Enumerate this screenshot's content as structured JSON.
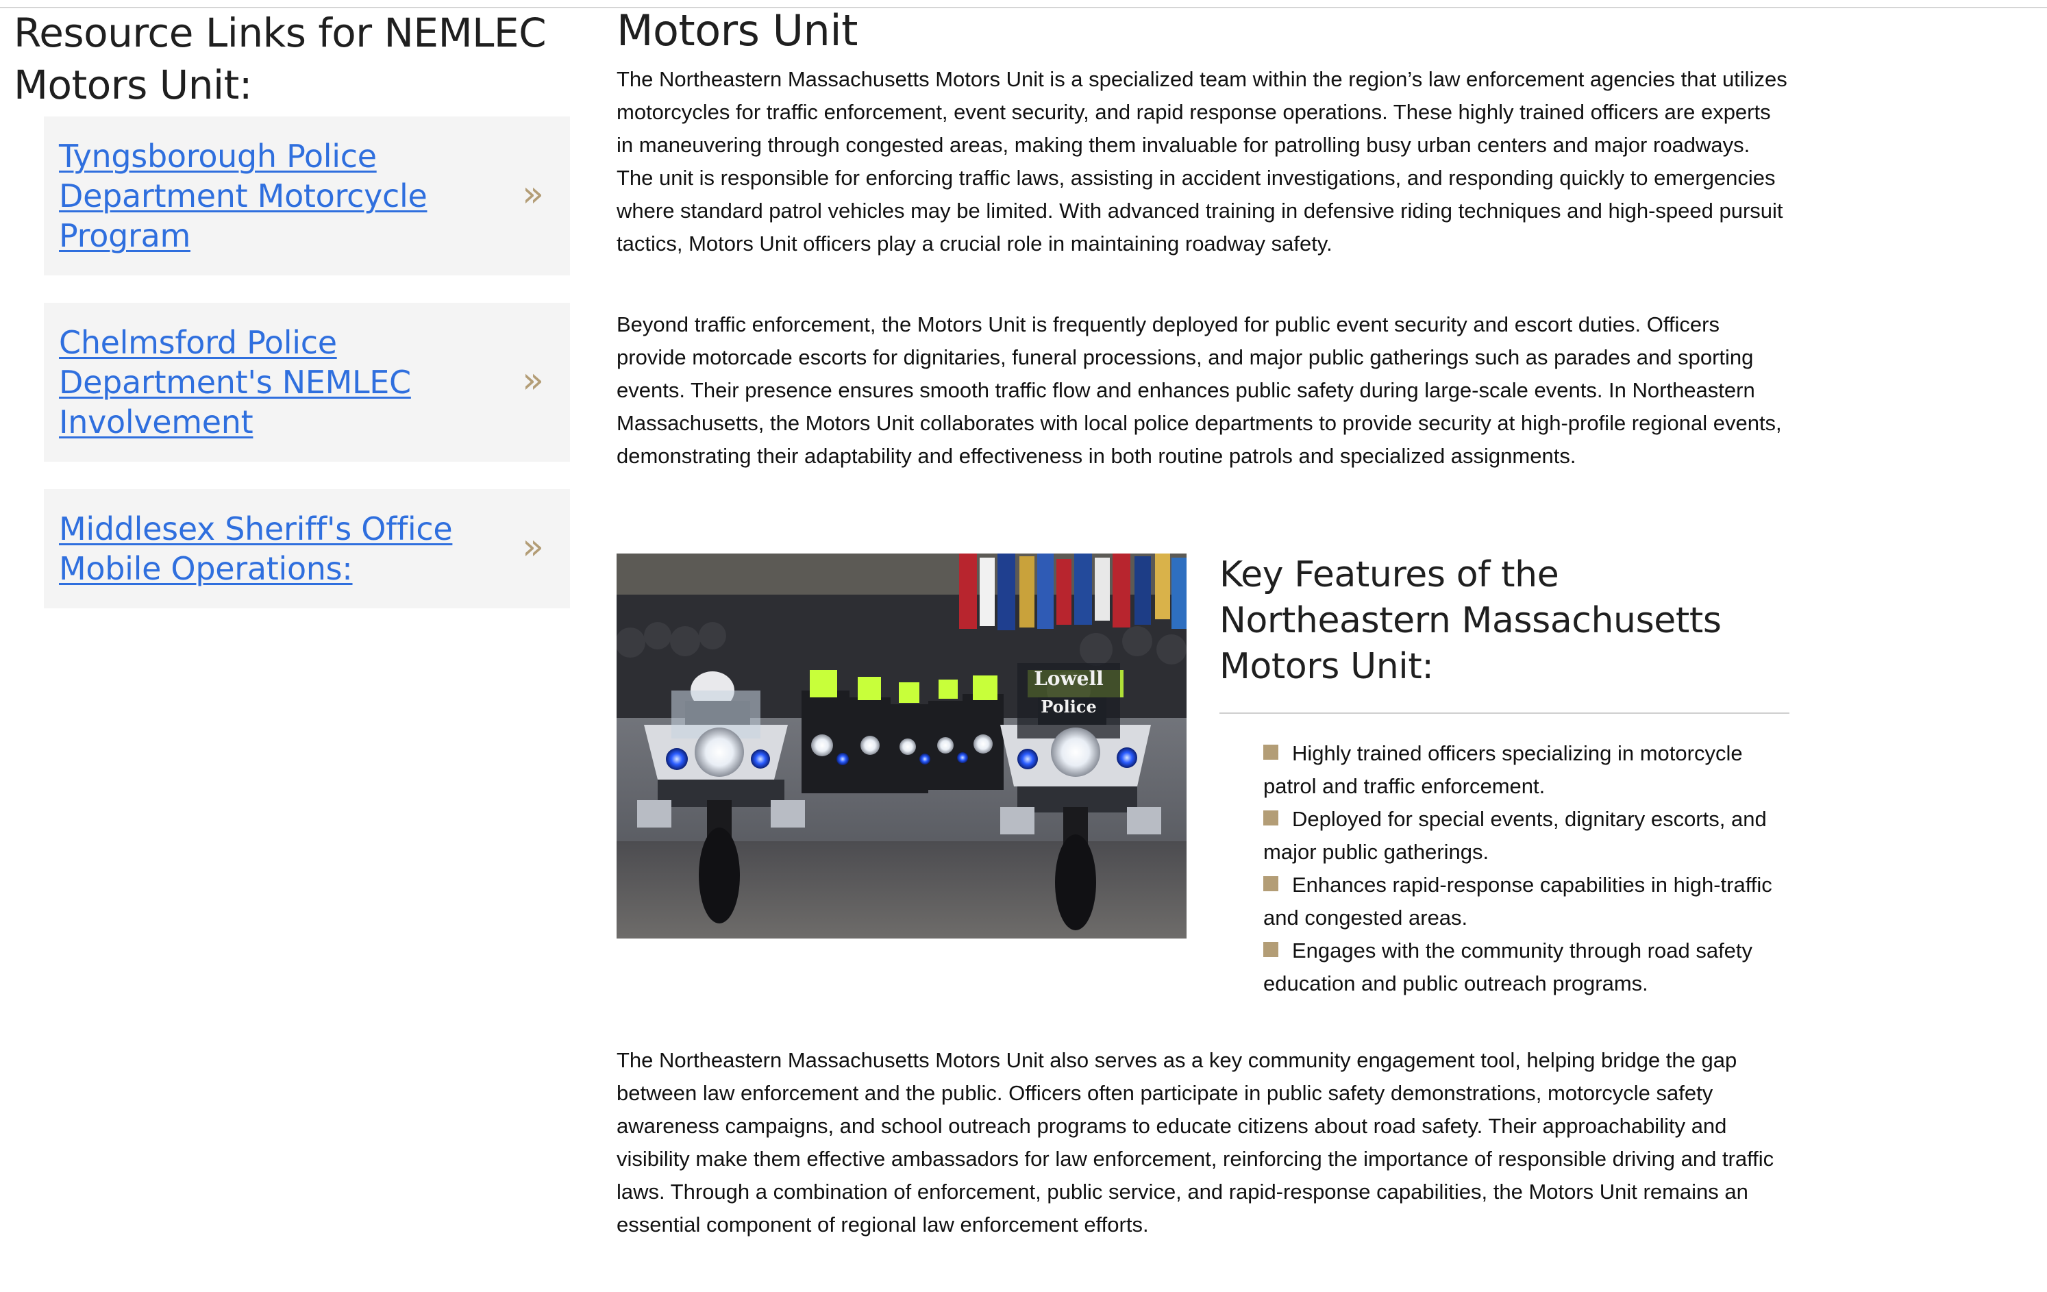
{
  "sidebar": {
    "title": "Resource Links for NEMLEC Motors Unit:",
    "links": [
      {
        "label": "Tyngsborough Police Department Motorcycle Program",
        "chevron": "»"
      },
      {
        "label": "Chelmsford Police Department's NEMLEC Involvement",
        "chevron": "»"
      },
      {
        "label": "Middlesex Sheriff's Office Mobile Operations:",
        "chevron": "»"
      }
    ]
  },
  "main": {
    "title": "Motors Unit",
    "paragraphs": [
      "The Northeastern Massachusetts Motors Unit is a specialized team within the region’s law enforcement agencies that utilizes motorcycles for traffic enforcement, event security, and rapid response operations. These highly trained officers are experts in maneuvering through congested areas, making them invaluable for patrolling busy urban centers and major roadways. The unit is responsible for enforcing traffic laws, assisting in accident investigations, and responding quickly to emergencies where standard patrol vehicles may be limited. With advanced training in defensive riding techniques and high-speed pursuit tactics, Motors Unit officers play a crucial role in maintaining roadway safety.",
      "Beyond traffic enforcement, the Motors Unit is frequently deployed for public event security and escort duties. Officers provide motorcade escorts for dignitaries, funeral processions, and major public gatherings such as parades and sporting events. Their presence ensures smooth traffic flow and enhances public safety during large-scale events. In Northeastern Massachusetts, the Motors Unit collaborates with local police departments to provide security at high-profile regional events, demonstrating their adaptability and effectiveness in both routine patrols and specialized assignments.",
      "The Northeastern Massachusetts Motors Unit also serves as a key community engagement tool, helping bridge the gap between law enforcement and the public. Officers often participate in public safety demonstrations, motorcycle safety awareness campaigns, and school outreach programs to educate citizens about road safety. Their approachability and visibility make them effective ambassadors for law enforcement, reinforcing the importance of responsible driving and traffic laws. Through a combination of enforcement, public service, and rapid-response capabilities, the Motors Unit remains an essential component of regional law enforcement efforts."
    ],
    "photo": {
      "windshield_text_1": "Lowell",
      "windshield_text_2": "Police"
    },
    "features": {
      "title": "Key Features of the Northeastern Massachusetts Motors Unit:",
      "items": [
        "Highly trained officers specializing in motorcycle patrol and traffic enforcement.",
        "Deployed for special events, dignitary escorts, and major public gatherings.",
        "Enhances rapid-response capabilities in high-traffic and congested areas.",
        "Engages with the community through road safety education and public outreach programs."
      ]
    }
  },
  "colors": {
    "link": "#2f6fde",
    "accent": "#b39d76",
    "card_bg": "#f4f4f4",
    "text": "#111111",
    "heading": "#1f1f1f"
  }
}
